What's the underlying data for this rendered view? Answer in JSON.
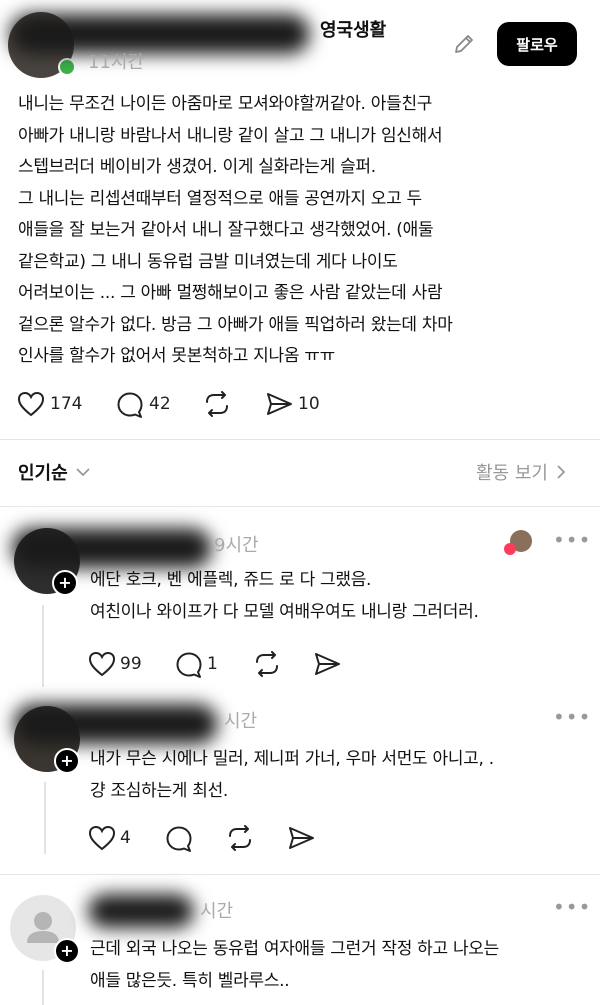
{
  "post": {
    "community": "영국생활",
    "time": "11시간",
    "follow_label": "팔로우",
    "lines": [
      "내니는 무조건 나이든 아줌마로 모셔와야할꺼같아. 아들친구",
      "아빠가 내니랑 바람나서 내니랑 같이 살고 그 내니가 임신해서",
      "스텝브러더 베이비가 생겼어. 이게 실화라는게 슬퍼.",
      "그 내니는 리셉션때부터 열정적으로 애들 공연까지 오고 두",
      "애들을 잘 보는거 같아서 내니 잘구했다고 생각했었어. (애둘",
      "같은학교) 그 내니 동유럽 금발 미녀였는데 게다 나이도",
      "어려보이는 ... 그 아빠 멀쩡해보이고 좋은 사람 같았는데 사람",
      "겉으론 알수가 없다. 방금 그 아빠가 애들 픽업하러 왔는데 차마",
      "인사를 할수가 없어서 못본척하고 지나옴 ㅠㅠ"
    ],
    "likes": "174",
    "comments": "42",
    "shares": "10"
  },
  "sort": {
    "label": "인기순",
    "activity_label": "활동 보기"
  },
  "replies": [
    {
      "time": "9시간",
      "lines": [
        "에단 호크, 벤 에플렉, 쥬드 로 다 그랬음.",
        "여친이나 와이프가 다 모델 여배우여도 내니랑 그러더러."
      ],
      "likes": "99",
      "comments": "1"
    },
    {
      "time": "시간",
      "lines": [
        "내가 무슨 시에나 밀러, 제니퍼 가너, 우마 서먼도 아니고, .",
        "걍 조심하는게 최선."
      ],
      "likes": "4"
    },
    {
      "time": "시간",
      "lines": [
        "근데 외국 나오는 동유럽 여자애들 그런거 작정 하고 나오는",
        "애들 많은듯. 특히 벨라루스.."
      ]
    }
  ],
  "icons": {
    "edit": "pencil-icon",
    "like": "heart-icon",
    "comment": "speech-bubble-icon",
    "repost": "repost-icon",
    "share": "send-icon",
    "more": "more-icon"
  }
}
